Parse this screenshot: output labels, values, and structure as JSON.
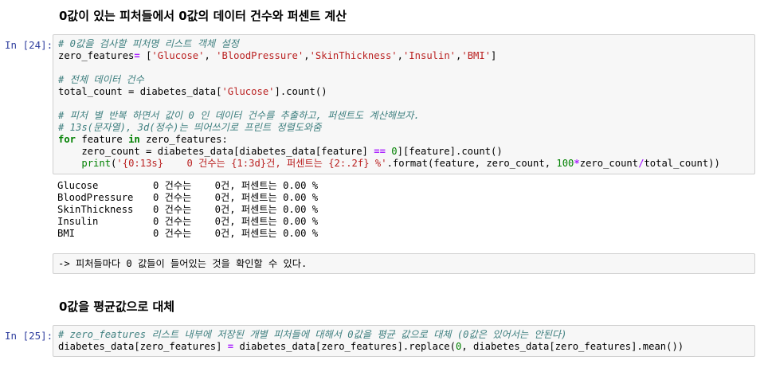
{
  "heading1": "0값이 있는 피처들에서 0값의 데이터 건수와 퍼센트 계산",
  "heading2": "0값을 평균값으로 대체",
  "cell24": {
    "prompt": "In [24]:",
    "comment1": "# 0값을 검사할 피처명 리스트 객체 설정",
    "line1_name": "zero_features",
    "line1_eq": " = [",
    "line1_items": [
      "'Glucose'",
      "'BloodPressure'",
      "'SkinThickness'",
      "'Insulin'",
      "'BMI'"
    ],
    "comment2": "# 전체 데이터 건수",
    "line2": "total_count = diabetes_data[",
    "line2_str": "'Glucose'",
    "line2_end": "].count()",
    "comment3": "# 피처 별 반복 하면서 값이 0 인 데이터 건수를 추출하고, 퍼센트도 계산해보자.",
    "comment4": "# 13s(문자열), 3d(정수)는 띄어쓰기로 프린트 정렬도와줌",
    "for_kw": "for",
    "for_mid": " feature ",
    "in_kw": "in",
    "for_end": " zero_features:",
    "zc_a": "    zero_count = diabetes_data[diabetes_data[feature] ",
    "zc_op": "==",
    "zc_sp": " ",
    "zc_num": "0",
    "zc_end": "][feature].count()",
    "pr_indent": "    ",
    "pr_fn": "print",
    "pr_open": "(",
    "pr_str": "'{0:13s}    0 건수는 {1:3d}건, 퍼센트는 {2:.2f} %'",
    "pr_fmt": ".format(feature, zero_count, ",
    "pr_num": "100",
    "pr_op1": "*",
    "pr_mid": "zero_count",
    "pr_op2": "/",
    "pr_end": "total_count))"
  },
  "output24": [
    {
      "name": "Glucose",
      "text": "0 건수는    0건, 퍼센트는 0.00 %"
    },
    {
      "name": "BloodPressure",
      "text": "0 건수는    0건, 퍼센트는 0.00 %"
    },
    {
      "name": "SkinThickness",
      "text": "0 건수는    0건, 퍼센트는 0.00 %"
    },
    {
      "name": "Insulin",
      "text": "0 건수는    0건, 퍼센트는 0.00 %"
    },
    {
      "name": "BMI",
      "text": "0 건수는    0건, 퍼센트는 0.00 %"
    }
  ],
  "md_note": "-> 피처들마다 0 값들이 들어있는 것을 확인할 수 있다.",
  "cell25": {
    "prompt": "In [25]:",
    "comment1": "# zero_features 리스트 내부에 저장된 개별 피처들에 대해서 0값을 평균 값으로 대체 (0값은 있어서는 안된다)",
    "line_a": "diabetes_data[zero_features] ",
    "line_eq": "=",
    "line_b": " diabetes_data[zero_features].replace(",
    "line_num": "0",
    "line_c": ", diabetes_data[zero_features].mean())"
  }
}
